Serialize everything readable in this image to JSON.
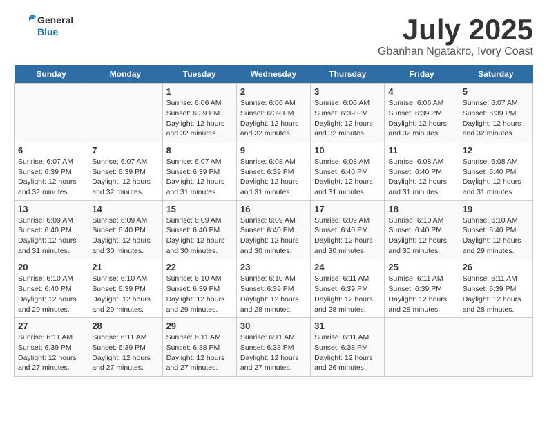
{
  "header": {
    "logo_line1": "General",
    "logo_line2": "Blue",
    "month": "July 2025",
    "location": "Gbanhan Ngatakro, Ivory Coast"
  },
  "days_of_week": [
    "Sunday",
    "Monday",
    "Tuesday",
    "Wednesday",
    "Thursday",
    "Friday",
    "Saturday"
  ],
  "weeks": [
    [
      {
        "day": "",
        "sunrise": "",
        "sunset": "",
        "daylight": ""
      },
      {
        "day": "",
        "sunrise": "",
        "sunset": "",
        "daylight": ""
      },
      {
        "day": "1",
        "sunrise": "Sunrise: 6:06 AM",
        "sunset": "Sunset: 6:39 PM",
        "daylight": "Daylight: 12 hours and 32 minutes."
      },
      {
        "day": "2",
        "sunrise": "Sunrise: 6:06 AM",
        "sunset": "Sunset: 6:39 PM",
        "daylight": "Daylight: 12 hours and 32 minutes."
      },
      {
        "day": "3",
        "sunrise": "Sunrise: 6:06 AM",
        "sunset": "Sunset: 6:39 PM",
        "daylight": "Daylight: 12 hours and 32 minutes."
      },
      {
        "day": "4",
        "sunrise": "Sunrise: 6:06 AM",
        "sunset": "Sunset: 6:39 PM",
        "daylight": "Daylight: 12 hours and 32 minutes."
      },
      {
        "day": "5",
        "sunrise": "Sunrise: 6:07 AM",
        "sunset": "Sunset: 6:39 PM",
        "daylight": "Daylight: 12 hours and 32 minutes."
      }
    ],
    [
      {
        "day": "6",
        "sunrise": "Sunrise: 6:07 AM",
        "sunset": "Sunset: 6:39 PM",
        "daylight": "Daylight: 12 hours and 32 minutes."
      },
      {
        "day": "7",
        "sunrise": "Sunrise: 6:07 AM",
        "sunset": "Sunset: 6:39 PM",
        "daylight": "Daylight: 12 hours and 32 minutes."
      },
      {
        "day": "8",
        "sunrise": "Sunrise: 6:07 AM",
        "sunset": "Sunset: 6:39 PM",
        "daylight": "Daylight: 12 hours and 31 minutes."
      },
      {
        "day": "9",
        "sunrise": "Sunrise: 6:08 AM",
        "sunset": "Sunset: 6:39 PM",
        "daylight": "Daylight: 12 hours and 31 minutes."
      },
      {
        "day": "10",
        "sunrise": "Sunrise: 6:08 AM",
        "sunset": "Sunset: 6:40 PM",
        "daylight": "Daylight: 12 hours and 31 minutes."
      },
      {
        "day": "11",
        "sunrise": "Sunrise: 6:08 AM",
        "sunset": "Sunset: 6:40 PM",
        "daylight": "Daylight: 12 hours and 31 minutes."
      },
      {
        "day": "12",
        "sunrise": "Sunrise: 6:08 AM",
        "sunset": "Sunset: 6:40 PM",
        "daylight": "Daylight: 12 hours and 31 minutes."
      }
    ],
    [
      {
        "day": "13",
        "sunrise": "Sunrise: 6:09 AM",
        "sunset": "Sunset: 6:40 PM",
        "daylight": "Daylight: 12 hours and 31 minutes."
      },
      {
        "day": "14",
        "sunrise": "Sunrise: 6:09 AM",
        "sunset": "Sunset: 6:40 PM",
        "daylight": "Daylight: 12 hours and 30 minutes."
      },
      {
        "day": "15",
        "sunrise": "Sunrise: 6:09 AM",
        "sunset": "Sunset: 6:40 PM",
        "daylight": "Daylight: 12 hours and 30 minutes."
      },
      {
        "day": "16",
        "sunrise": "Sunrise: 6:09 AM",
        "sunset": "Sunset: 6:40 PM",
        "daylight": "Daylight: 12 hours and 30 minutes."
      },
      {
        "day": "17",
        "sunrise": "Sunrise: 6:09 AM",
        "sunset": "Sunset: 6:40 PM",
        "daylight": "Daylight: 12 hours and 30 minutes."
      },
      {
        "day": "18",
        "sunrise": "Sunrise: 6:10 AM",
        "sunset": "Sunset: 6:40 PM",
        "daylight": "Daylight: 12 hours and 30 minutes."
      },
      {
        "day": "19",
        "sunrise": "Sunrise: 6:10 AM",
        "sunset": "Sunset: 6:40 PM",
        "daylight": "Daylight: 12 hours and 29 minutes."
      }
    ],
    [
      {
        "day": "20",
        "sunrise": "Sunrise: 6:10 AM",
        "sunset": "Sunset: 6:40 PM",
        "daylight": "Daylight: 12 hours and 29 minutes."
      },
      {
        "day": "21",
        "sunrise": "Sunrise: 6:10 AM",
        "sunset": "Sunset: 6:39 PM",
        "daylight": "Daylight: 12 hours and 29 minutes."
      },
      {
        "day": "22",
        "sunrise": "Sunrise: 6:10 AM",
        "sunset": "Sunset: 6:39 PM",
        "daylight": "Daylight: 12 hours and 29 minutes."
      },
      {
        "day": "23",
        "sunrise": "Sunrise: 6:10 AM",
        "sunset": "Sunset: 6:39 PM",
        "daylight": "Daylight: 12 hours and 28 minutes."
      },
      {
        "day": "24",
        "sunrise": "Sunrise: 6:11 AM",
        "sunset": "Sunset: 6:39 PM",
        "daylight": "Daylight: 12 hours and 28 minutes."
      },
      {
        "day": "25",
        "sunrise": "Sunrise: 6:11 AM",
        "sunset": "Sunset: 6:39 PM",
        "daylight": "Daylight: 12 hours and 28 minutes."
      },
      {
        "day": "26",
        "sunrise": "Sunrise: 6:11 AM",
        "sunset": "Sunset: 6:39 PM",
        "daylight": "Daylight: 12 hours and 28 minutes."
      }
    ],
    [
      {
        "day": "27",
        "sunrise": "Sunrise: 6:11 AM",
        "sunset": "Sunset: 6:39 PM",
        "daylight": "Daylight: 12 hours and 27 minutes."
      },
      {
        "day": "28",
        "sunrise": "Sunrise: 6:11 AM",
        "sunset": "Sunset: 6:39 PM",
        "daylight": "Daylight: 12 hours and 27 minutes."
      },
      {
        "day": "29",
        "sunrise": "Sunrise: 6:11 AM",
        "sunset": "Sunset: 6:38 PM",
        "daylight": "Daylight: 12 hours and 27 minutes."
      },
      {
        "day": "30",
        "sunrise": "Sunrise: 6:11 AM",
        "sunset": "Sunset: 6:38 PM",
        "daylight": "Daylight: 12 hours and 27 minutes."
      },
      {
        "day": "31",
        "sunrise": "Sunrise: 6:11 AM",
        "sunset": "Sunset: 6:38 PM",
        "daylight": "Daylight: 12 hours and 26 minutes."
      },
      {
        "day": "",
        "sunrise": "",
        "sunset": "",
        "daylight": ""
      },
      {
        "day": "",
        "sunrise": "",
        "sunset": "",
        "daylight": ""
      }
    ]
  ]
}
